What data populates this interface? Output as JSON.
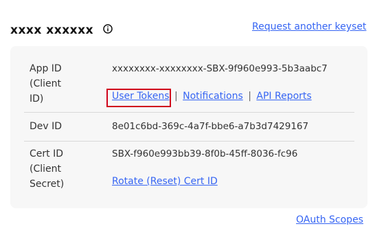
{
  "header": {
    "keyset_title": "xxxx xxxxxx",
    "info_icon": "info-circle-icon",
    "request_link": "Request another keyset"
  },
  "keys": {
    "app_id": {
      "label": "App ID (Client ID)",
      "value": "xxxxxxxx-xxxxxxxx-SBX-9f960e993-5b3aabc7",
      "links": {
        "user_tokens": "User Tokens",
        "separator": "|",
        "notifications": "Notifications",
        "api_reports": "API Reports"
      }
    },
    "dev_id": {
      "label": "Dev ID",
      "value": "8e01c6bd-369c-4a7f-bbe6-a7b3d7429167"
    },
    "cert_id": {
      "label": "Cert ID (Client Secret)",
      "value": "SBX-f960e993bb39-8f0b-45ff-8036-fc96",
      "rotate_link": "Rotate (Reset) Cert ID"
    }
  },
  "footer": {
    "oauth_link": "OAuth Scopes"
  },
  "colors": {
    "link": "#3665f3",
    "highlight_border": "#d0021b",
    "panel_bg": "#f7f7f7"
  }
}
